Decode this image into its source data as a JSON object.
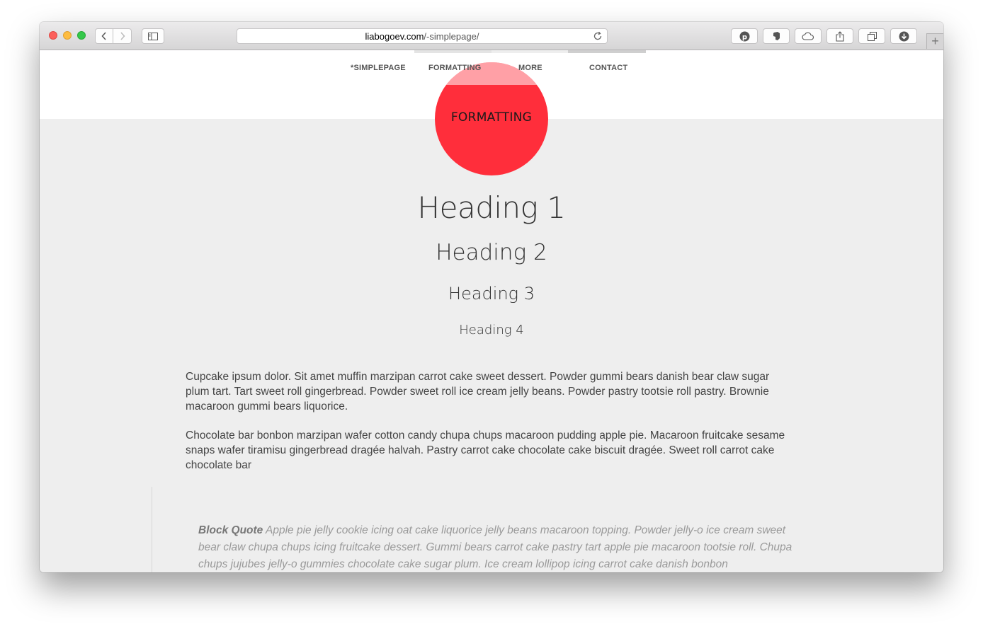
{
  "browser": {
    "url_domain": "liabogoev.com",
    "url_path": "/-simplepage/"
  },
  "nav": {
    "items": [
      "*SIMPLEPAGE",
      "FORMATTING",
      "MORE",
      "CONTACT"
    ]
  },
  "hero": {
    "circle_label": "FORMATTING",
    "circle_color": "#ff2e3b"
  },
  "content": {
    "h1": "Heading 1",
    "h2": "Heading 2",
    "h3": "Heading 3",
    "h4": "Heading 4",
    "paragraph1": "Cupcake ipsum dolor. Sit amet muffin marzipan carrot cake sweet dessert. Powder gummi bears danish bear claw sugar plum tart. Tart sweet roll gingerbread. Powder sweet roll ice cream jelly beans. Powder pastry tootsie roll pastry. Brownie macaroon gummi bears liquorice.",
    "paragraph2": "Chocolate bar bonbon marzipan wafer cotton candy chupa chups macaroon pudding apple pie. Macaroon fruitcake sesame snaps wafer tiramisu gingerbread dragée halvah. Pastry carrot cake chocolate cake biscuit dragée. Sweet roll carrot cake chocolate bar",
    "quote_label": "Block Quote",
    "quote_text": "Apple pie jelly cookie icing oat cake liquorice jelly beans macaroon topping. Powder jelly-o ice cream sweet bear claw chupa chups icing fruitcake dessert. Gummi bears carrot cake pastry tart apple pie macaroon tootsie roll. Chupa chups jujubes jelly-o gummies chocolate cake sugar plum. Ice cream lollipop icing carrot cake danish bonbon"
  }
}
